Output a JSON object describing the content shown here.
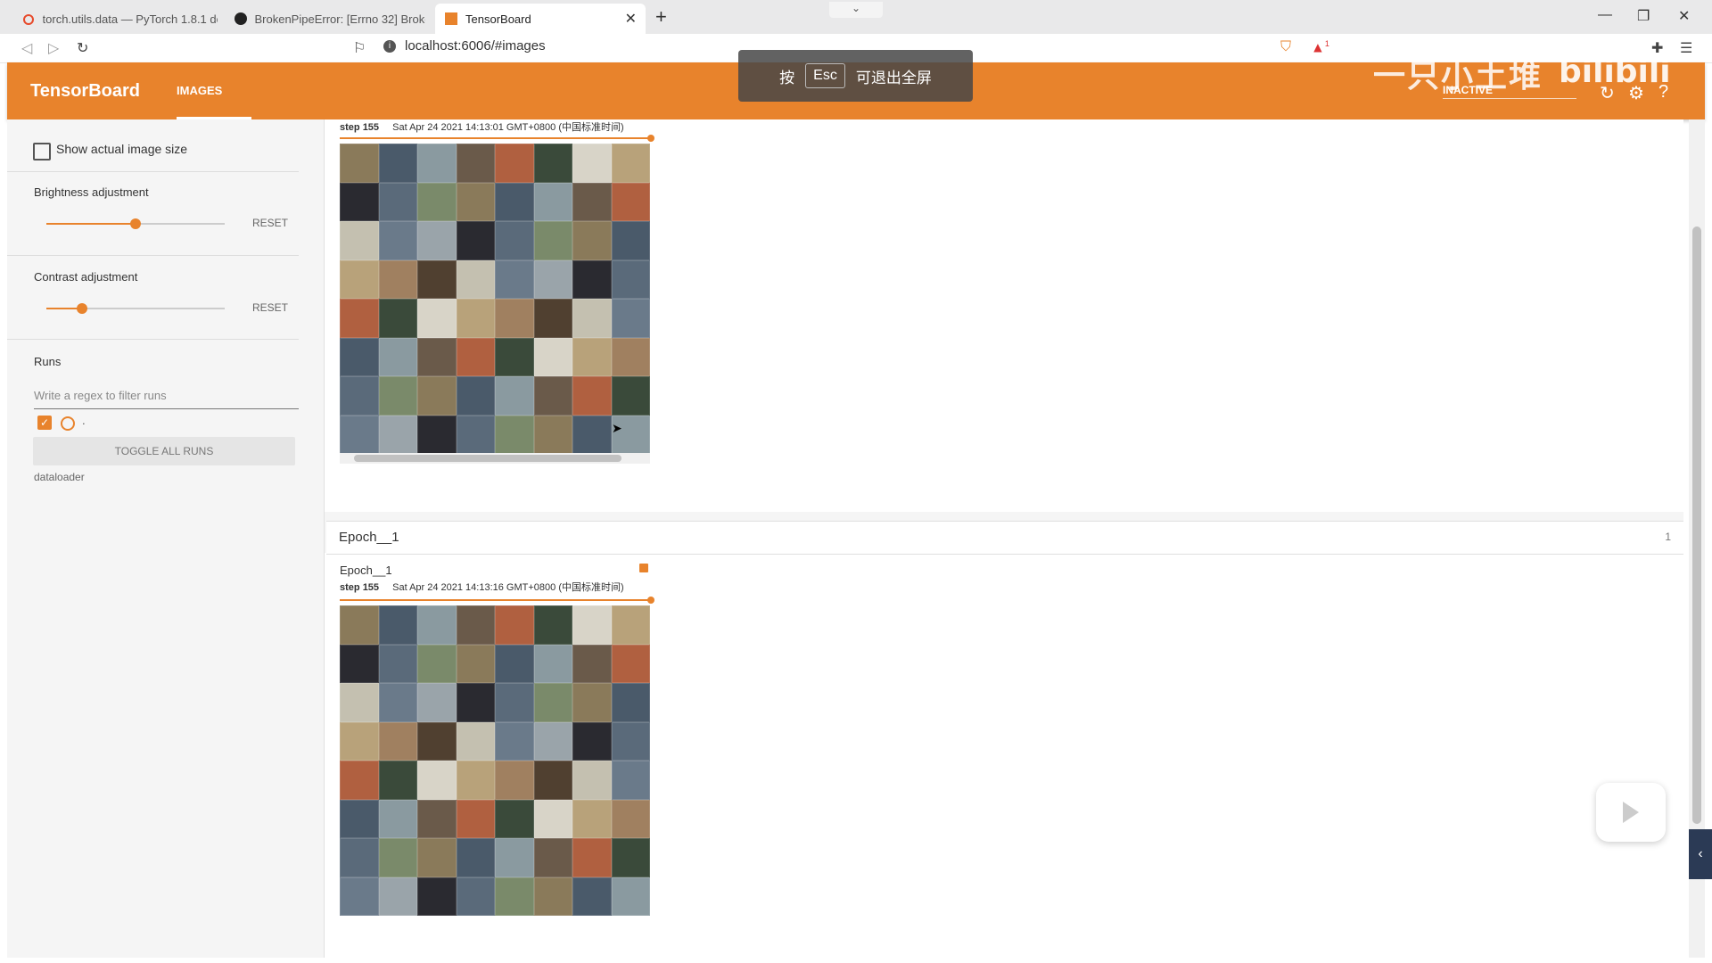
{
  "browser": {
    "tabs": [
      {
        "title": "torch.utils.data — PyTorch 1.8.1 do",
        "icon": "pytorch-icon"
      },
      {
        "title": "BrokenPipeError: [Errno 32] Broke",
        "icon": "github-icon"
      },
      {
        "title": "TensorBoard",
        "icon": "tensorboard-icon"
      }
    ],
    "url": "localhost:6006/#images",
    "alert_count": "1"
  },
  "fullscreen_banner": {
    "prefix": "按",
    "key": "Esc",
    "suffix": "可退出全屏"
  },
  "watermark": {
    "text": "一只小土堆",
    "logo": "bilibili"
  },
  "header": {
    "title": "TensorBoard",
    "tab": "IMAGES",
    "status": "INACTIVE"
  },
  "sidebar": {
    "show_actual_size": "Show actual image size",
    "brightness": {
      "label": "Brightness adjustment",
      "reset": "RESET",
      "value": 0.5
    },
    "contrast": {
      "label": "Contrast adjustment",
      "reset": "RESET",
      "value": 0.2
    },
    "runs": {
      "label": "Runs",
      "filter_placeholder": "Write a regex to filter runs",
      "run_name": ".",
      "toggle": "TOGGLE ALL RUNS",
      "dataloader": "dataloader"
    }
  },
  "cards": [
    {
      "step_label": "step",
      "step": "155",
      "timestamp": "Sat Apr 24 2021 14:13:01 GMT+0800 (中国标准时间)"
    },
    {
      "title": "Epoch__1",
      "step_label": "step",
      "step": "155",
      "timestamp": "Sat Apr 24 2021 14:13:16 GMT+0800 (中国标准时间)"
    }
  ],
  "section": {
    "title": "Epoch__1",
    "count": "1"
  },
  "colors": {
    "accent": "#e8832c",
    "panel": "#f5f5f5"
  }
}
